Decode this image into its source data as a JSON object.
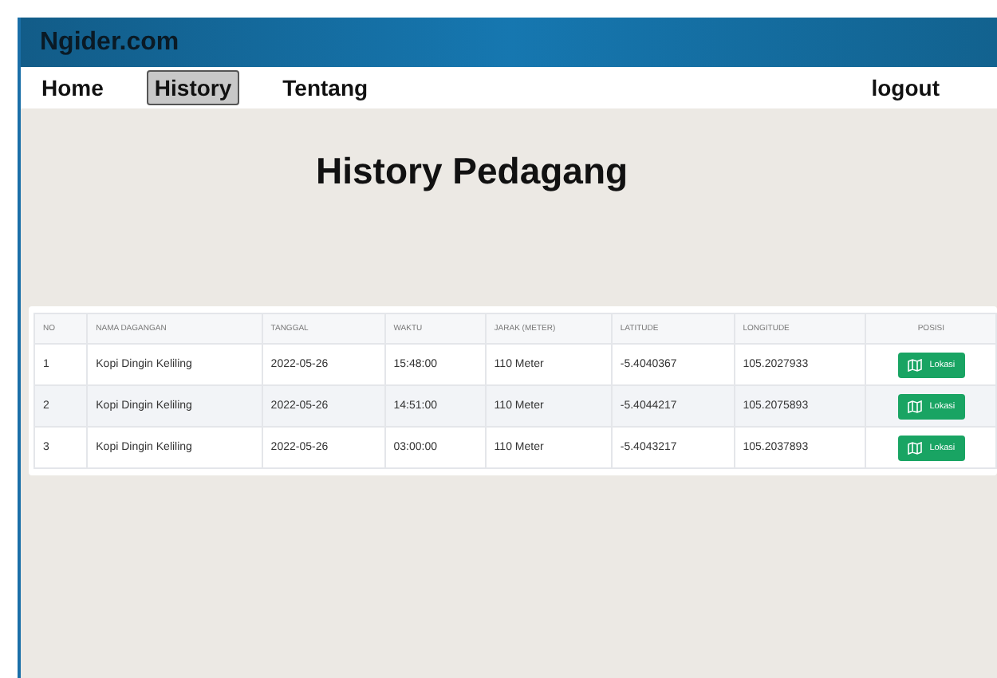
{
  "brand": "Ngider.com",
  "nav": [
    {
      "label": "Home",
      "selected": false
    },
    {
      "label": "History",
      "selected": true
    },
    {
      "label": "Tentang",
      "selected": false
    }
  ],
  "logout": "logout",
  "heading": "History Pedagang",
  "table": {
    "columns": [
      "NO",
      "NAMA DAGANGAN",
      "TANGGAL",
      "WAKTU",
      "JARAK (METER)",
      "LATITUDE",
      "LONGITUDE",
      "POSISI"
    ],
    "rows": [
      {
        "cells": [
          "1",
          "Kopi Dingin Keliling",
          "2022-05-26",
          "15:48:00",
          "110 Meter",
          "-5.4040367",
          "105.2027933"
        ],
        "button": "Lokasi"
      },
      {
        "cells": [
          "2",
          "Kopi Dingin Keliling",
          "2022-05-26",
          "14:51:00",
          "110 Meter",
          "-5.4044217",
          "105.2075893"
        ],
        "button": "Lokasi"
      },
      {
        "cells": [
          "3",
          "Kopi Dingin Keliling",
          "2022-05-26",
          "03:00:00",
          "110 Meter",
          "-5.4043217",
          "105.2037893"
        ],
        "button": "Lokasi"
      }
    ]
  }
}
